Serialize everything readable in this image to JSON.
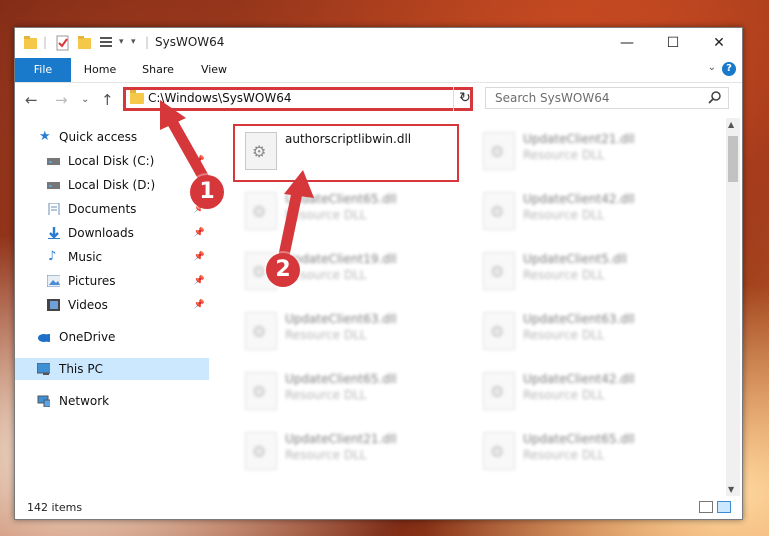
{
  "window": {
    "title": "SysWOW64",
    "controls": {
      "minimize": "—",
      "maximize": "☐",
      "close": "✕"
    }
  },
  "ribbon": {
    "tabs": [
      "File",
      "Home",
      "Share",
      "View"
    ],
    "expand": "⌄",
    "help": "?"
  },
  "address": {
    "path": "C:\\Windows\\SysWOW64",
    "dropdown": "⌄",
    "refresh": "↻"
  },
  "search": {
    "placeholder": "Search SysWOW64",
    "icon": "search-icon"
  },
  "nav_buttons": {
    "back": "←",
    "forward": "→",
    "recent": "⌄",
    "up": "↑"
  },
  "sidebar": {
    "items": [
      {
        "label": "Quick access",
        "icon": "star-icon"
      },
      {
        "label": "Local Disk (C:)",
        "icon": "drive-icon",
        "pinned": true
      },
      {
        "label": "Local Disk (D:)",
        "icon": "drive-icon",
        "pinned": true
      },
      {
        "label": "Documents",
        "icon": "documents-icon",
        "pinned": true
      },
      {
        "label": "Downloads",
        "icon": "downloads-icon",
        "pinned": true
      },
      {
        "label": "Music",
        "icon": "music-icon",
        "pinned": true
      },
      {
        "label": "Pictures",
        "icon": "pictures-icon",
        "pinned": true
      },
      {
        "label": "Videos",
        "icon": "videos-icon",
        "pinned": true
      },
      {
        "label": "OneDrive",
        "icon": "cloud-icon"
      },
      {
        "label": "This PC",
        "icon": "computer-icon",
        "selected": true
      },
      {
        "label": "Network",
        "icon": "network-icon"
      }
    ]
  },
  "files": {
    "highlighted": {
      "name": "authorscriptlibwin.dll",
      "type": ""
    },
    "blurred": [
      {
        "name": "UpdateClient21.dll",
        "type": "Resource DLL"
      },
      {
        "name": "UpdateClient65.dll",
        "type": "Resource DLL"
      },
      {
        "name": "UpdateClient42.dll",
        "type": "Resource DLL"
      },
      {
        "name": "UpdateClient19.dll",
        "type": "Resource DLL"
      },
      {
        "name": "UpdateClient5.dll",
        "type": "Resource DLL"
      },
      {
        "name": "UpdateClient63.dll",
        "type": "Resource DLL"
      },
      {
        "name": "UpdateClient63.dll",
        "type": "Resource DLL"
      },
      {
        "name": "UpdateClient65.dll",
        "type": "Resource DLL"
      },
      {
        "name": "UpdateClient42.dll",
        "type": "Resource DLL"
      },
      {
        "name": "UpdateClient21.dll",
        "type": "Resource DLL"
      },
      {
        "name": "UpdateClient65.dll",
        "type": "Resource DLL"
      }
    ]
  },
  "status": {
    "item_count": "142 items"
  },
  "annotations": {
    "step1": "1",
    "step2": "2",
    "accent": "#d6373a"
  }
}
